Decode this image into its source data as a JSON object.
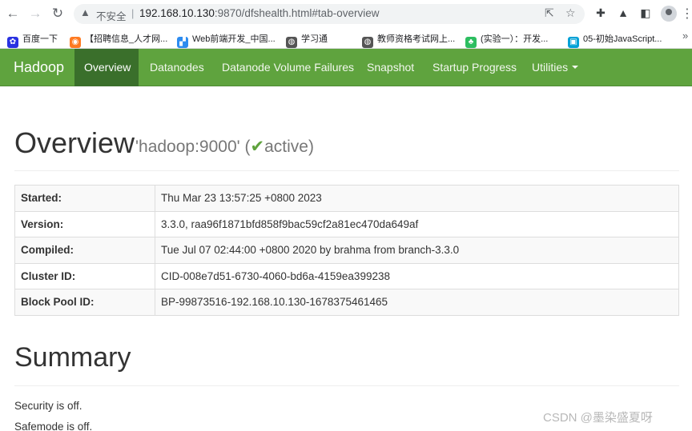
{
  "browser": {
    "insecure_label": "不安全",
    "separator": "|",
    "url_host": "192.168.10.130",
    "url_path": ":9870/dfshealth.html#tab-overview",
    "bookmarks": [
      {
        "label": "百度一下",
        "icon": "baidu-paw-icon",
        "color": "#2932e1"
      },
      {
        "label": "【招聘信息_人才网...",
        "icon": "job-site-icon",
        "color": "#ff7a21"
      },
      {
        "label": "Web前端开发_中国...",
        "icon": "windows-flag-icon",
        "color": "#2d8cf0"
      },
      {
        "label": "学习通",
        "icon": "globe-icon",
        "color": "#555555"
      },
      {
        "label": "教师资格考试网上...",
        "icon": "globe-icon",
        "color": "#555555"
      },
      {
        "label": "(实验一）：开发...",
        "icon": "evernote-icon",
        "color": "#2dbe60"
      },
      {
        "label": "05-初始JavaScript...",
        "icon": "bilibili-icon",
        "color": "#00a1d6"
      }
    ]
  },
  "navbar": {
    "brand": "Hadoop",
    "items": [
      "Overview",
      "Datanodes",
      "Datanode Volume Failures",
      "Snapshot",
      "Startup Progress",
      "Utilities"
    ],
    "active": "Overview",
    "color": "#5fa33e",
    "active_color": "#3a6f2b"
  },
  "overview": {
    "title": "Overview",
    "host_quoted": "'hadoop:9000'",
    "paren_open": "(",
    "check_glyph": "✔",
    "status": "active",
    "paren_close": ")"
  },
  "info_rows": [
    {
      "label": "Started:",
      "value": "Thu Mar 23 13:57:25 +0800 2023"
    },
    {
      "label": "Version:",
      "value": "3.3.0, raa96f1871bfd858f9bac59cf2a81ec470da649af"
    },
    {
      "label": "Compiled:",
      "value": "Tue Jul 07 02:44:00 +0800 2020 by brahma from branch-3.3.0"
    },
    {
      "label": "Cluster ID:",
      "value": "CID-008e7d51-6730-4060-bd6a-4159ea399238"
    },
    {
      "label": "Block Pool ID:",
      "value": "BP-99873516-192.168.10.130-1678375461465"
    }
  ],
  "summary": {
    "title": "Summary",
    "lines": [
      "Security is off.",
      "Safemode is off."
    ]
  },
  "watermark": "CSDN @墨染盛夏呀"
}
